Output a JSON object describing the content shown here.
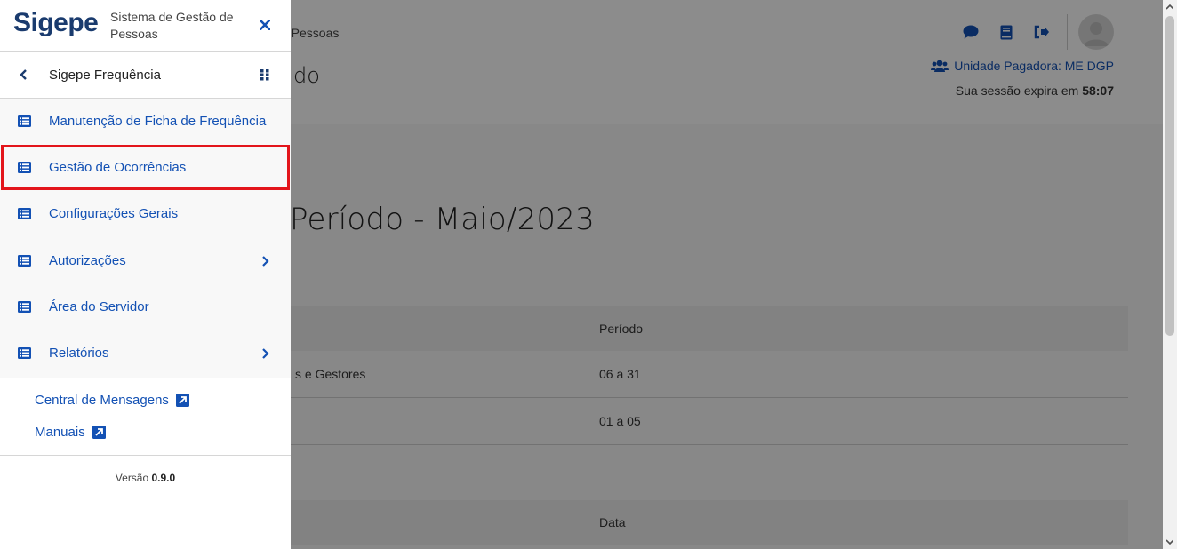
{
  "background": {
    "breadcrumb": "e Pessoas",
    "title_fragment": "do",
    "unit_label": "Unidade Pagadora: ME DGP",
    "session_prefix": "Sua sessão expira em",
    "session_time": "58:07",
    "section_title": "Período - Maio/2023",
    "table1": {
      "header": "Período",
      "rows": [
        {
          "c1": "s e Gestores",
          "c2": "06 a 31"
        },
        {
          "c1": "",
          "c2": "01 a 05"
        }
      ]
    },
    "table2": {
      "header": "Data"
    }
  },
  "sidebar": {
    "logo": "Sigepe",
    "subtitle": "Sistema de Gestão de Pessoas",
    "system_label": "Sigepe Frequência",
    "menu": [
      {
        "label": "Manutenção de Ficha de Frequência",
        "has_submenu": false
      },
      {
        "label": "Gestão de Ocorrências",
        "has_submenu": false,
        "highlighted": true
      },
      {
        "label": "Configurações Gerais",
        "has_submenu": false
      },
      {
        "label": "Autorizações",
        "has_submenu": true
      },
      {
        "label": "Área do Servidor",
        "has_submenu": false
      },
      {
        "label": "Relatórios",
        "has_submenu": true
      }
    ],
    "links": [
      {
        "label": "Central de Mensagens"
      },
      {
        "label": "Manuais"
      }
    ],
    "version_prefix": "Versão",
    "version_number": "0.9.0"
  },
  "colors": {
    "brand": "#1a3b6e",
    "link": "#1351b4",
    "highlight": "#e3151b"
  }
}
